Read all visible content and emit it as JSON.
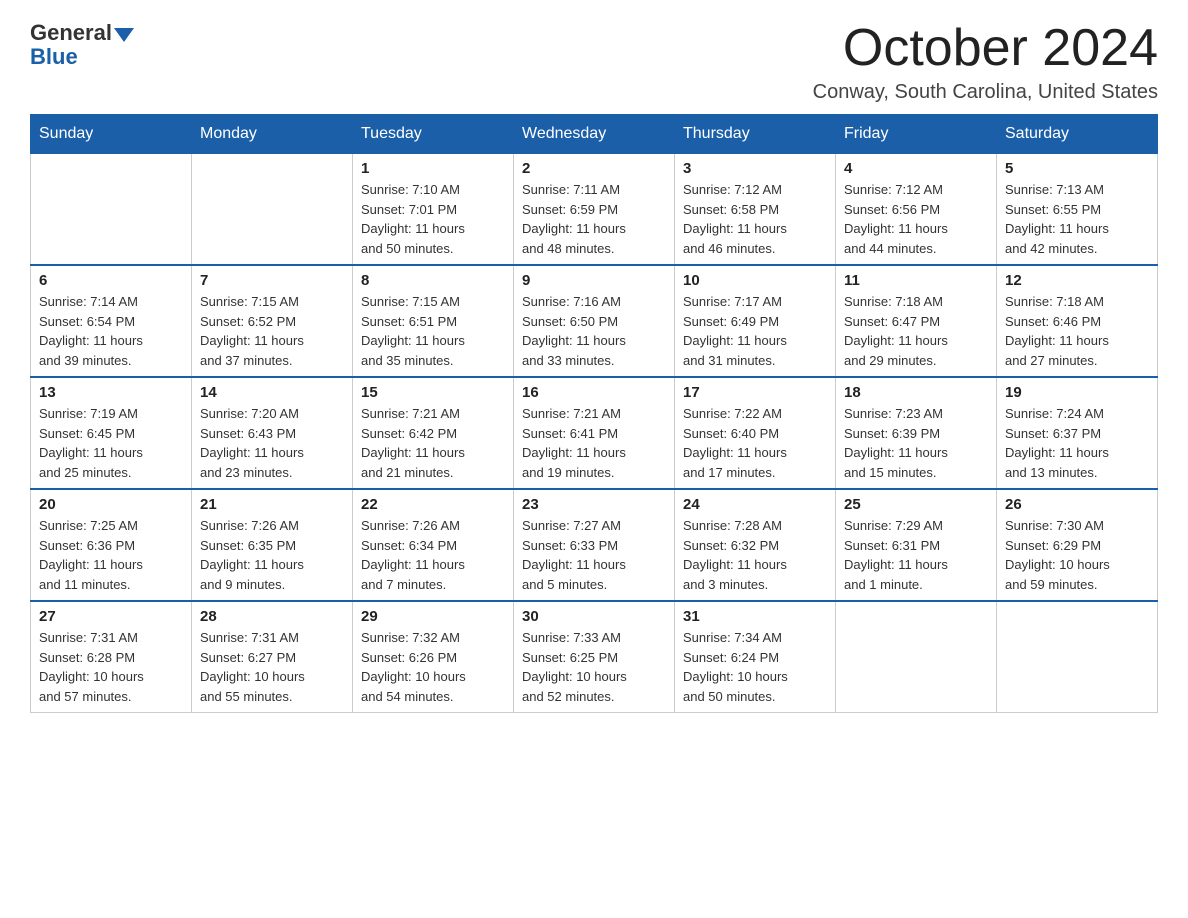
{
  "header": {
    "logo_general": "General",
    "logo_blue": "Blue",
    "month_title": "October 2024",
    "location": "Conway, South Carolina, United States"
  },
  "weekdays": [
    "Sunday",
    "Monday",
    "Tuesday",
    "Wednesday",
    "Thursday",
    "Friday",
    "Saturday"
  ],
  "weeks": [
    [
      {
        "day": "",
        "info": ""
      },
      {
        "day": "",
        "info": ""
      },
      {
        "day": "1",
        "info": "Sunrise: 7:10 AM\nSunset: 7:01 PM\nDaylight: 11 hours\nand 50 minutes."
      },
      {
        "day": "2",
        "info": "Sunrise: 7:11 AM\nSunset: 6:59 PM\nDaylight: 11 hours\nand 48 minutes."
      },
      {
        "day": "3",
        "info": "Sunrise: 7:12 AM\nSunset: 6:58 PM\nDaylight: 11 hours\nand 46 minutes."
      },
      {
        "day": "4",
        "info": "Sunrise: 7:12 AM\nSunset: 6:56 PM\nDaylight: 11 hours\nand 44 minutes."
      },
      {
        "day": "5",
        "info": "Sunrise: 7:13 AM\nSunset: 6:55 PM\nDaylight: 11 hours\nand 42 minutes."
      }
    ],
    [
      {
        "day": "6",
        "info": "Sunrise: 7:14 AM\nSunset: 6:54 PM\nDaylight: 11 hours\nand 39 minutes."
      },
      {
        "day": "7",
        "info": "Sunrise: 7:15 AM\nSunset: 6:52 PM\nDaylight: 11 hours\nand 37 minutes."
      },
      {
        "day": "8",
        "info": "Sunrise: 7:15 AM\nSunset: 6:51 PM\nDaylight: 11 hours\nand 35 minutes."
      },
      {
        "day": "9",
        "info": "Sunrise: 7:16 AM\nSunset: 6:50 PM\nDaylight: 11 hours\nand 33 minutes."
      },
      {
        "day": "10",
        "info": "Sunrise: 7:17 AM\nSunset: 6:49 PM\nDaylight: 11 hours\nand 31 minutes."
      },
      {
        "day": "11",
        "info": "Sunrise: 7:18 AM\nSunset: 6:47 PM\nDaylight: 11 hours\nand 29 minutes."
      },
      {
        "day": "12",
        "info": "Sunrise: 7:18 AM\nSunset: 6:46 PM\nDaylight: 11 hours\nand 27 minutes."
      }
    ],
    [
      {
        "day": "13",
        "info": "Sunrise: 7:19 AM\nSunset: 6:45 PM\nDaylight: 11 hours\nand 25 minutes."
      },
      {
        "day": "14",
        "info": "Sunrise: 7:20 AM\nSunset: 6:43 PM\nDaylight: 11 hours\nand 23 minutes."
      },
      {
        "day": "15",
        "info": "Sunrise: 7:21 AM\nSunset: 6:42 PM\nDaylight: 11 hours\nand 21 minutes."
      },
      {
        "day": "16",
        "info": "Sunrise: 7:21 AM\nSunset: 6:41 PM\nDaylight: 11 hours\nand 19 minutes."
      },
      {
        "day": "17",
        "info": "Sunrise: 7:22 AM\nSunset: 6:40 PM\nDaylight: 11 hours\nand 17 minutes."
      },
      {
        "day": "18",
        "info": "Sunrise: 7:23 AM\nSunset: 6:39 PM\nDaylight: 11 hours\nand 15 minutes."
      },
      {
        "day": "19",
        "info": "Sunrise: 7:24 AM\nSunset: 6:37 PM\nDaylight: 11 hours\nand 13 minutes."
      }
    ],
    [
      {
        "day": "20",
        "info": "Sunrise: 7:25 AM\nSunset: 6:36 PM\nDaylight: 11 hours\nand 11 minutes."
      },
      {
        "day": "21",
        "info": "Sunrise: 7:26 AM\nSunset: 6:35 PM\nDaylight: 11 hours\nand 9 minutes."
      },
      {
        "day": "22",
        "info": "Sunrise: 7:26 AM\nSunset: 6:34 PM\nDaylight: 11 hours\nand 7 minutes."
      },
      {
        "day": "23",
        "info": "Sunrise: 7:27 AM\nSunset: 6:33 PM\nDaylight: 11 hours\nand 5 minutes."
      },
      {
        "day": "24",
        "info": "Sunrise: 7:28 AM\nSunset: 6:32 PM\nDaylight: 11 hours\nand 3 minutes."
      },
      {
        "day": "25",
        "info": "Sunrise: 7:29 AM\nSunset: 6:31 PM\nDaylight: 11 hours\nand 1 minute."
      },
      {
        "day": "26",
        "info": "Sunrise: 7:30 AM\nSunset: 6:29 PM\nDaylight: 10 hours\nand 59 minutes."
      }
    ],
    [
      {
        "day": "27",
        "info": "Sunrise: 7:31 AM\nSunset: 6:28 PM\nDaylight: 10 hours\nand 57 minutes."
      },
      {
        "day": "28",
        "info": "Sunrise: 7:31 AM\nSunset: 6:27 PM\nDaylight: 10 hours\nand 55 minutes."
      },
      {
        "day": "29",
        "info": "Sunrise: 7:32 AM\nSunset: 6:26 PM\nDaylight: 10 hours\nand 54 minutes."
      },
      {
        "day": "30",
        "info": "Sunrise: 7:33 AM\nSunset: 6:25 PM\nDaylight: 10 hours\nand 52 minutes."
      },
      {
        "day": "31",
        "info": "Sunrise: 7:34 AM\nSunset: 6:24 PM\nDaylight: 10 hours\nand 50 minutes."
      },
      {
        "day": "",
        "info": ""
      },
      {
        "day": "",
        "info": ""
      }
    ]
  ]
}
